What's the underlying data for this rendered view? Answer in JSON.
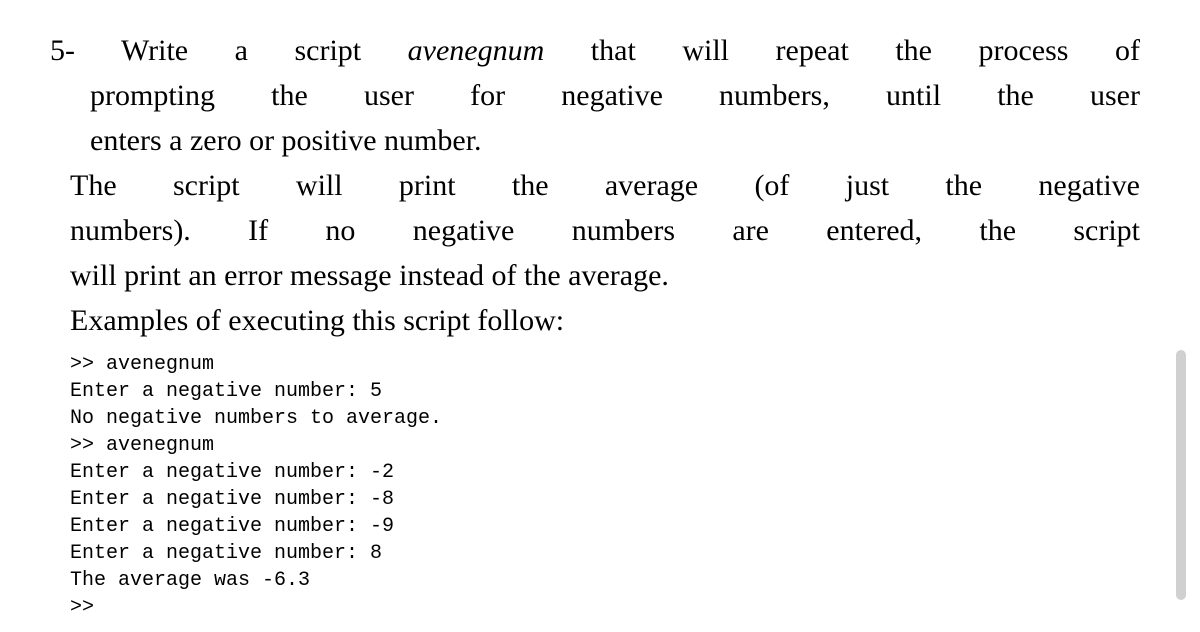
{
  "problem": {
    "number": "5-",
    "line1_prefix": "Write a script ",
    "script_name": "avenegnum",
    "line1_suffix": " that will repeat the process of",
    "line2": "prompting the user for negative numbers, until the user",
    "line3": "enters a zero or positive number.",
    "para2_line1": "The script will print the average (of just the negative",
    "para2_line2": "numbers). If no negative numbers are entered, the script",
    "para2_line3": "will print an error message instead of the average.",
    "examples_intro": "Examples of executing this script follow:"
  },
  "code": {
    "lines": [
      ">> avenegnum",
      "Enter a negative number: 5",
      "No negative numbers to average.",
      ">> avenegnum",
      "Enter a negative number: -2",
      "Enter a negative number: -8",
      "Enter a negative number: -9",
      "Enter a negative number: 8",
      "The average was -6.3",
      ">>"
    ]
  }
}
